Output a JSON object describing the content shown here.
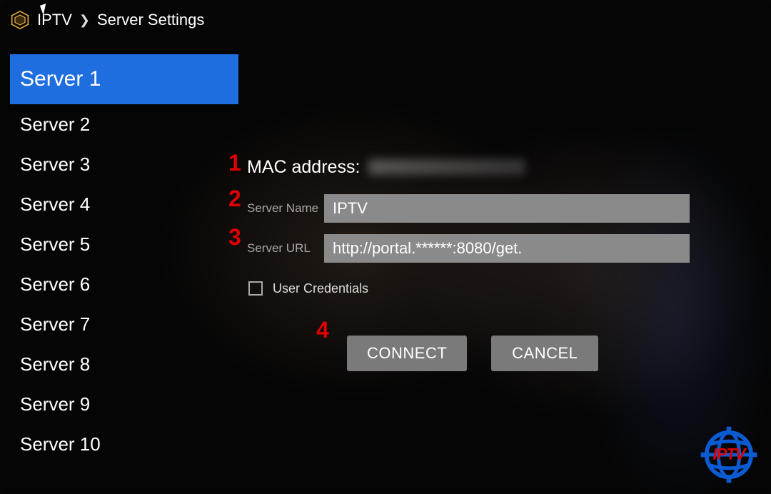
{
  "breadcrumb": {
    "app": "IPTV",
    "page": "Server Settings"
  },
  "sidebar": {
    "items": [
      {
        "label": "Server 1",
        "selected": true
      },
      {
        "label": "Server 2",
        "selected": false
      },
      {
        "label": "Server 3",
        "selected": false
      },
      {
        "label": "Server 4",
        "selected": false
      },
      {
        "label": "Server 5",
        "selected": false
      },
      {
        "label": "Server 6",
        "selected": false
      },
      {
        "label": "Server 7",
        "selected": false
      },
      {
        "label": "Server 8",
        "selected": false
      },
      {
        "label": "Server 9",
        "selected": false
      },
      {
        "label": "Server 10",
        "selected": false
      }
    ]
  },
  "form": {
    "mac_label": "MAC address:",
    "server_name_label": "Server Name",
    "server_name_value": "IPTV",
    "server_url_label": "Server URL",
    "server_url_value": "http://portal.******:8080/get.",
    "credentials_label": "User Credentials",
    "credentials_checked": false,
    "connect_label": "CONNECT",
    "cancel_label": "CANCEL"
  },
  "annotations": {
    "n1": "1",
    "n2": "2",
    "n3": "3",
    "n4": "4"
  },
  "logo": {
    "text": "IPTV"
  },
  "colors": {
    "selection": "#1f6ee0",
    "annotation": "#e10000",
    "logo_blue": "#0b5bd3",
    "logo_red": "#e10000",
    "input_bg": "#8a8a8a",
    "button_bg": "#7a7a7a"
  }
}
